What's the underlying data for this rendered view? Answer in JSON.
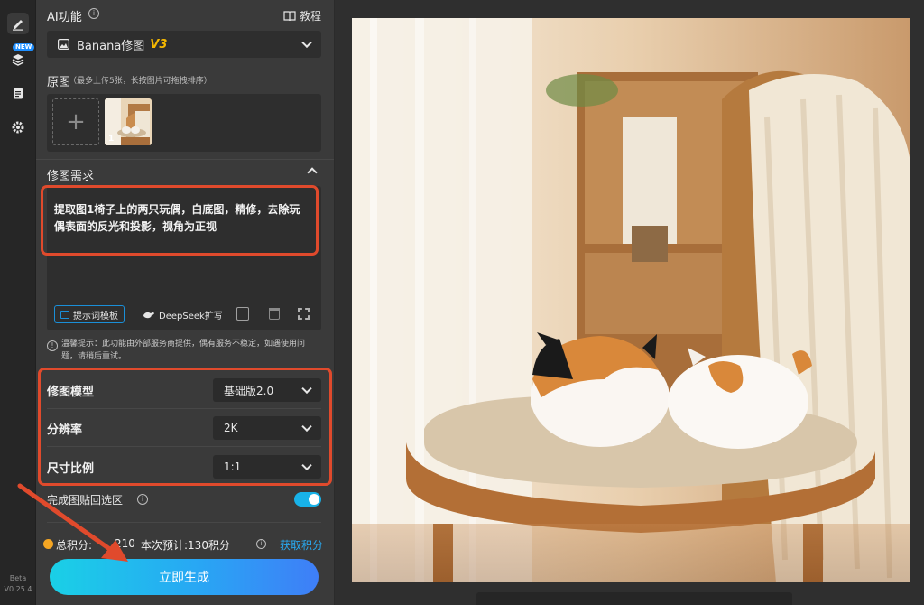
{
  "sidebar": {
    "new_badge": "NEW",
    "version_line1": "Beta",
    "version_line2": "V0.25.4",
    "icons": [
      "edit-icon",
      "layers-icon",
      "clipboard-icon",
      "gear-icon"
    ]
  },
  "panel": {
    "ai_title": "AI功能",
    "tutorial": "教程",
    "function_select": "Banana修图",
    "function_version": "V3",
    "original_title": "原图",
    "original_hint": "（最多上传5张，长按图片可拖拽排序）",
    "thumb_index": "1",
    "requirement_title": "修图需求",
    "prompt_text": "提取图1椅子上的两只玩偶，白底图，精修，去除玩偶表面的反光和投影，视角为正视",
    "prompt_template_btn": "提示词模板",
    "deepseek_btn": "DeepSeek扩写",
    "notice": "温馨提示：此功能由外部服务商提供，偶有服务不稳定，如遇使用问题，请稍后重试。",
    "settings": [
      {
        "label": "修图模型",
        "value": "基础版2.0"
      },
      {
        "label": "分辨率",
        "value": "2K"
      },
      {
        "label": "尺寸比例",
        "value": "1:1"
      }
    ],
    "paste_back_label": "完成图贴回选区",
    "paste_back_on": true,
    "points_label": "总积分:",
    "points_value": "210",
    "estimate": "本次预计:130积分",
    "get_points": "获取积分",
    "generate_btn": "立即生成"
  },
  "colors": {
    "accent": "#1ab4e8",
    "highlight": "#e04a2c",
    "brand_version": "#f5b800"
  }
}
